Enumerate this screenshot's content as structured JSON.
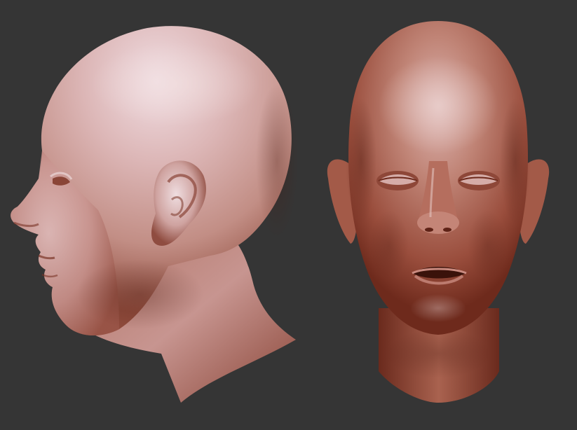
{
  "scene": {
    "background_color": "#353535",
    "skin_highlight": "#e9d2d6",
    "skin_mid": "#b97b70",
    "skin_shadow": "#7a3426",
    "views": [
      {
        "id": "profile",
        "orientation": "left-side"
      },
      {
        "id": "front",
        "orientation": "front"
      }
    ]
  }
}
